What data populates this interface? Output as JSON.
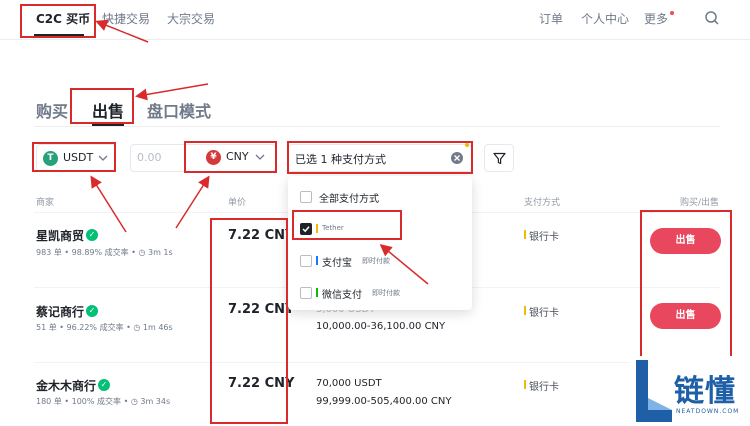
{
  "nav": {
    "items": [
      {
        "label": "C2C 买币",
        "active": true
      },
      {
        "label": "快捷交易",
        "active": false
      },
      {
        "label": "大宗交易",
        "active": false
      }
    ],
    "right": [
      "订单",
      "个人中心",
      "更多"
    ]
  },
  "mode_tabs": [
    {
      "label": "购买",
      "active": false
    },
    {
      "label": "出售",
      "active": true
    },
    {
      "label": "盘口模式",
      "active": false
    }
  ],
  "filters": {
    "coin": {
      "symbol": "T",
      "label": "USDT"
    },
    "amount": {
      "placeholder": "0.00"
    },
    "fiat": {
      "symbol": "¥",
      "label": "CNY"
    },
    "payment": {
      "label": "已选 1 种支付方式"
    }
  },
  "columns": {
    "merchant": "商家",
    "price": "单价",
    "payment": "支付方式",
    "action": "购买/出售"
  },
  "payment_dropdown": {
    "items": [
      {
        "label": "全部支付方式",
        "checked": false,
        "tag": ""
      },
      {
        "label": "Tether",
        "checked": true,
        "tag": ""
      },
      {
        "label": "支付宝",
        "checked": false,
        "tag": "即时付款"
      },
      {
        "label": "微信支付",
        "checked": false,
        "tag": "即时付款"
      }
    ]
  },
  "rows": [
    {
      "name": "星凯商贸",
      "stats": "983 单 • 98.89% 成交率 • ◷ 3m 1s",
      "price": "7.22 CNY",
      "avail_qty": "",
      "limit": "",
      "payment": "银行卡",
      "action": "出售"
    },
    {
      "name": "蔡记商行",
      "stats": "51 单 • 96.22% 成交率 • ◷ 1m 46s",
      "price": "7.22 CNY",
      "avail_qty": "5,000 USDT",
      "limit": "10,000.00-36,100.00 CNY",
      "payment": "银行卡",
      "action": "出售"
    },
    {
      "name": "金木木商行",
      "stats": "180 单 • 100% 成交率 • ◷ 3m 34s",
      "price": "7.22 CNY",
      "avail_qty": "70,000 USDT",
      "limit": "99,999.00-505,400.00 CNY",
      "payment": "银行卡",
      "action": ""
    }
  ],
  "logo": {
    "text": "链懂",
    "sub": "NEATDOWN.COM"
  },
  "colors": {
    "accent_red": "#e8475d",
    "annotation_red": "#d92b2b",
    "tether_green": "#26a17b",
    "cny_red": "#d43a3a",
    "verified_green": "#02c076",
    "logo_blue": "#1f5fa8"
  }
}
